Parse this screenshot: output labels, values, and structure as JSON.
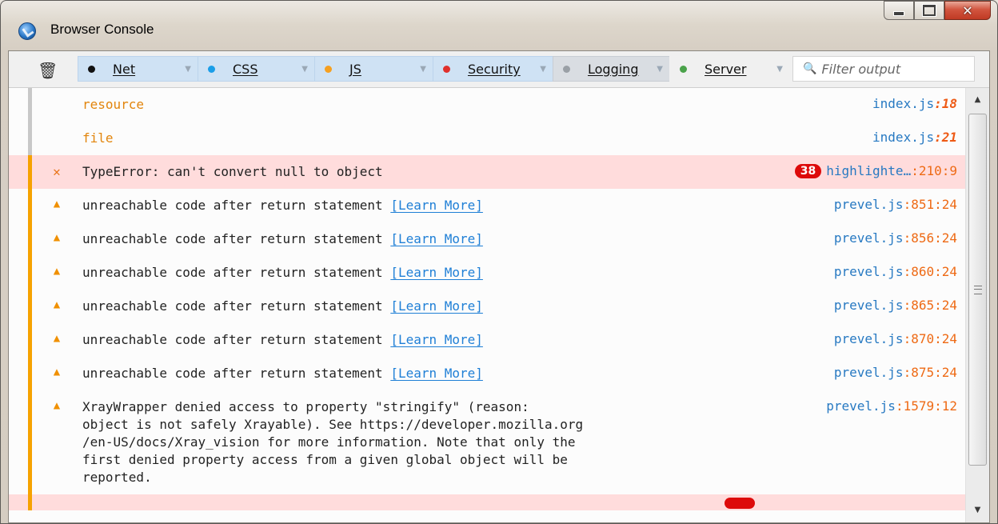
{
  "window": {
    "title": "Browser Console"
  },
  "toolbar": {
    "clear_icon": "trash-icon",
    "filters": [
      {
        "label": "Net",
        "color": "#111111",
        "state": "on"
      },
      {
        "label": "CSS",
        "color": "#1a9ee8",
        "state": "on"
      },
      {
        "label": "JS",
        "color": "#f6a020",
        "state": "on"
      },
      {
        "label": "Security",
        "color": "#e0302c",
        "state": "on"
      },
      {
        "label": "Logging",
        "color": "#9aa0a6",
        "state": "partial"
      },
      {
        "label": "Server",
        "color": "#4aa24a",
        "state": "off"
      }
    ],
    "filter_placeholder": "Filter output"
  },
  "messages": [
    {
      "severity": "log",
      "text": "resource",
      "source_file": "index.js",
      "source_line": ":18"
    },
    {
      "severity": "log",
      "text": "file",
      "source_file": "index.js",
      "source_line": ":21"
    },
    {
      "severity": "error",
      "text": "TypeError: can't convert null to object",
      "repeat_count": "38",
      "source_file": "highlighte…",
      "source_line": ":210:9"
    },
    {
      "severity": "warning",
      "text": "unreachable code after return statement ",
      "link": "[Learn More]",
      "source_file": "prevel.js",
      "source_line": ":851:24"
    },
    {
      "severity": "warning",
      "text": "unreachable code after return statement ",
      "link": "[Learn More]",
      "source_file": "prevel.js",
      "source_line": ":856:24"
    },
    {
      "severity": "warning",
      "text": "unreachable code after return statement ",
      "link": "[Learn More]",
      "source_file": "prevel.js",
      "source_line": ":860:24"
    },
    {
      "severity": "warning",
      "text": "unreachable code after return statement ",
      "link": "[Learn More]",
      "source_file": "prevel.js",
      "source_line": ":865:24"
    },
    {
      "severity": "warning",
      "text": "unreachable code after return statement ",
      "link": "[Learn More]",
      "source_file": "prevel.js",
      "source_line": ":870:24"
    },
    {
      "severity": "warning",
      "text": "unreachable code after return statement ",
      "link": "[Learn More]",
      "source_file": "prevel.js",
      "source_line": ":875:24"
    },
    {
      "severity": "warning",
      "text": "XrayWrapper denied access to property \"stringify\" (reason:\nobject is not safely Xrayable). See https://developer.mozilla.org\n/en-US/docs/Xray_vision for more information. Note that only the\nfirst denied property access from a given global object will be\nreported.",
      "source_file": "prevel.js",
      "source_line": ":1579:12"
    }
  ]
}
